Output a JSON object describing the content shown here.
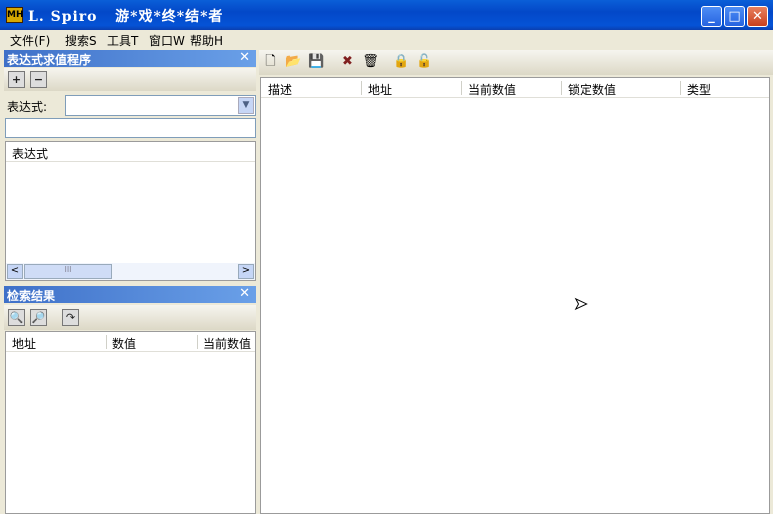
{
  "window": {
    "title": "L. Spiro   游*戏*终*结*者",
    "icon": "MH",
    "minimize": "_",
    "maximize": "□",
    "close": "✕"
  },
  "menu": [
    "文件(F)",
    "搜索S",
    "工具T",
    "窗口W",
    "帮助H"
  ],
  "expr_panel": {
    "title": "表达式求值程序",
    "close": "✕",
    "add": "+",
    "remove": "−",
    "label": "表达式:",
    "combo_value": "",
    "input_value": "",
    "list_header": "表达式",
    "scroll_left": "<",
    "scroll_right": ">",
    "thumb": "III"
  },
  "search_panel": {
    "title": "检索结果",
    "close": "✕",
    "columns": [
      "地址",
      "数值",
      "当前数值"
    ]
  },
  "main_list": {
    "columns": [
      "描述",
      "地址",
      "当前数值",
      "锁定数值",
      "类型"
    ]
  },
  "toolbar_icons": [
    "new-file-icon",
    "open-folder-icon",
    "save-icon",
    "delete-icon",
    "clear-icon",
    "lock-icon",
    "unlock-icon"
  ]
}
